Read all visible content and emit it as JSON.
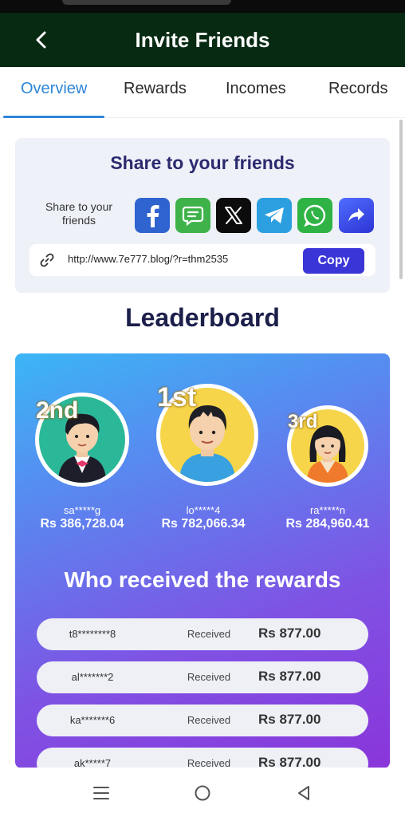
{
  "header": {
    "title": "Invite Friends"
  },
  "tabs": [
    "Overview",
    "Rewards",
    "Incomes",
    "Records"
  ],
  "share": {
    "title": "Share to your friends",
    "label": "Share to your friends",
    "icons": [
      "facebook-icon",
      "sms-icon",
      "x-icon",
      "telegram-icon",
      "whatsapp-icon",
      "share-icon"
    ],
    "link": "http://www.7e777.blog/?r=thm2535",
    "copy_label": "Copy"
  },
  "leaderboard": {
    "title": "Leaderboard",
    "entries": [
      {
        "rank": "2nd",
        "name": "sa*****g",
        "currency": "Rs",
        "amount": "386,728.04"
      },
      {
        "rank": "1st",
        "name": "lo*****4",
        "currency": "Rs",
        "amount": "782,066.34"
      },
      {
        "rank": "3rd",
        "name": "ra*****n",
        "currency": "Rs",
        "amount": "284,960.41"
      }
    ]
  },
  "rewards": {
    "title": "Who received the rewards",
    "rows": [
      {
        "name": "t8********8",
        "status": "Received",
        "currency": "Rs",
        "amount": "877.00"
      },
      {
        "name": "al*******2",
        "status": "Received",
        "currency": "Rs",
        "amount": "877.00"
      },
      {
        "name": "ka*******6",
        "status": "Received",
        "currency": "Rs",
        "amount": "877.00"
      },
      {
        "name": "ak*****7",
        "status": "Received",
        "currency": "Rs",
        "amount": "877.00"
      }
    ]
  },
  "colors": {
    "header_bg": "#062a12",
    "tab_active": "#2e86d8",
    "copy_button": "#3a35d6",
    "gradient_start": "#3bb6f6",
    "gradient_end": "#8a35da"
  }
}
